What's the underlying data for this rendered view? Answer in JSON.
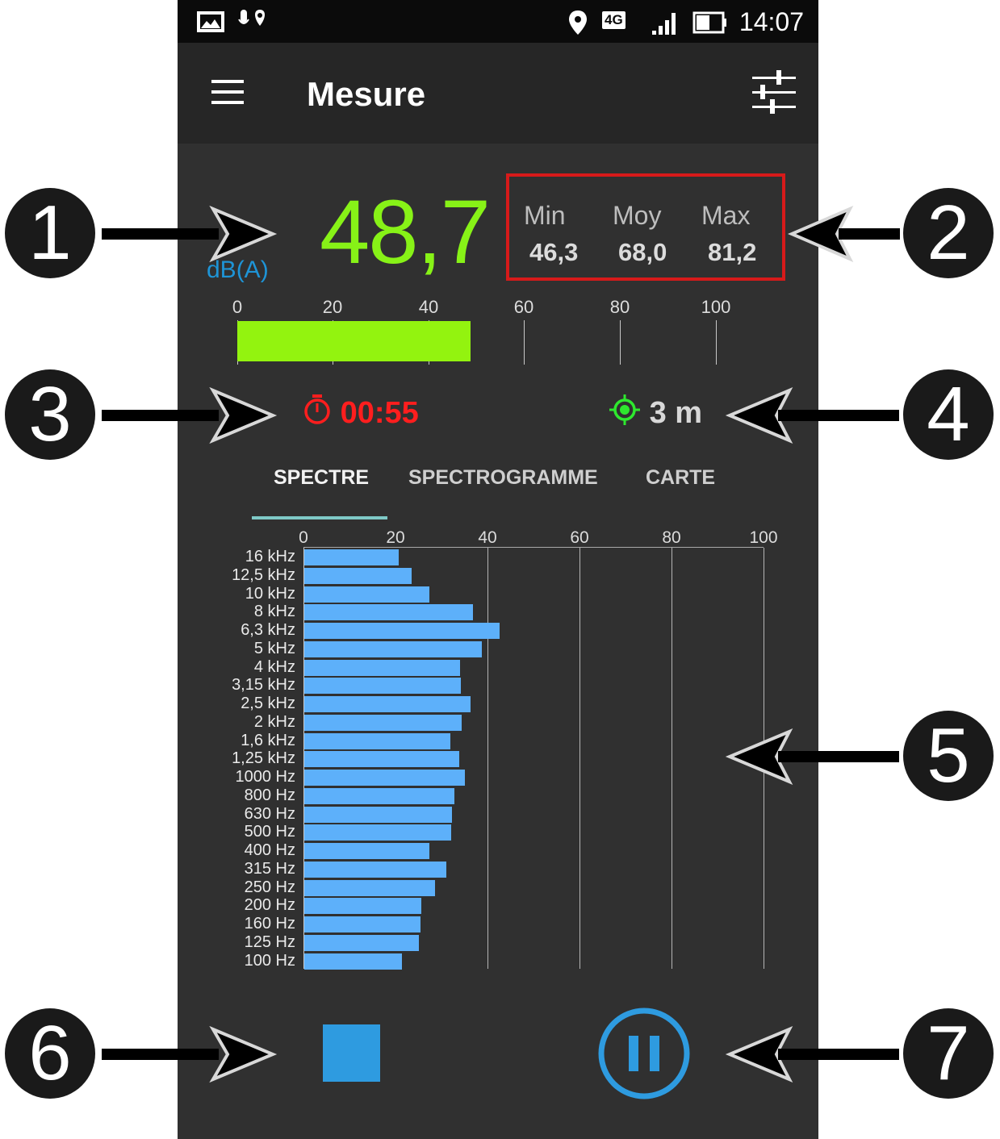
{
  "status_bar": {
    "time": "14:07",
    "network": "4G"
  },
  "app_bar": {
    "title": "Mesure",
    "menu_icon": "hamburger-menu-icon",
    "settings_icon": "sliders-settings-icon"
  },
  "level": {
    "value": "48,7",
    "unit": "dB(A)",
    "color": "#87f217"
  },
  "stats": {
    "min_label": "Min",
    "min_value": "46,3",
    "avg_label": "Moy",
    "avg_value": "68,0",
    "max_label": "Max",
    "max_value": "81,2",
    "box_color": "#d71a1a"
  },
  "gauge": {
    "ticks": [
      "0",
      "20",
      "40",
      "60",
      "80",
      "100"
    ],
    "value": 48.7,
    "max": 100,
    "color": "#93f30f"
  },
  "timer": {
    "value": "00:55",
    "icon": "stopwatch-icon",
    "color": "#ff1e1e"
  },
  "gps": {
    "value": "3 m",
    "icon": "gps-target-icon",
    "icon_color": "#2ee82e"
  },
  "tabs": [
    {
      "label": "SPECTRE",
      "active": true
    },
    {
      "label": "SPECTROGRAMME",
      "active": false
    },
    {
      "label": "CARTE",
      "active": false
    }
  ],
  "chart_data": {
    "type": "bar",
    "orientation": "horizontal",
    "xlim": [
      0,
      100
    ],
    "ticks": [
      "0",
      "20",
      "40",
      "60",
      "80",
      "100"
    ],
    "categories": [
      "16 kHz",
      "12,5 kHz",
      "10 kHz",
      "8 kHz",
      "6,3 kHz",
      "5 kHz",
      "4 kHz",
      "3,15 kHz",
      "2,5 kHz",
      "2 kHz",
      "1,6 kHz",
      "1,25 kHz",
      "1000 Hz",
      "800 Hz",
      "630 Hz",
      "500 Hz",
      "400 Hz",
      "315 Hz",
      "250 Hz",
      "200 Hz",
      "160 Hz",
      "125 Hz",
      "100 Hz"
    ],
    "values": [
      20.5,
      23.3,
      27.2,
      36.7,
      42.4,
      38.6,
      33.8,
      34.0,
      36.1,
      34.2,
      31.7,
      33.6,
      34.9,
      32.6,
      32.1,
      32.0,
      27.2,
      30.9,
      28.5,
      25.4,
      25.2,
      24.9,
      21.2
    ],
    "bar_color": "#5db0fa"
  },
  "controls": {
    "stop_icon": "stop-icon",
    "pause_icon": "pause-icon",
    "color": "#2e9be0"
  },
  "callouts": [
    "1",
    "2",
    "3",
    "4",
    "5",
    "6",
    "7"
  ]
}
